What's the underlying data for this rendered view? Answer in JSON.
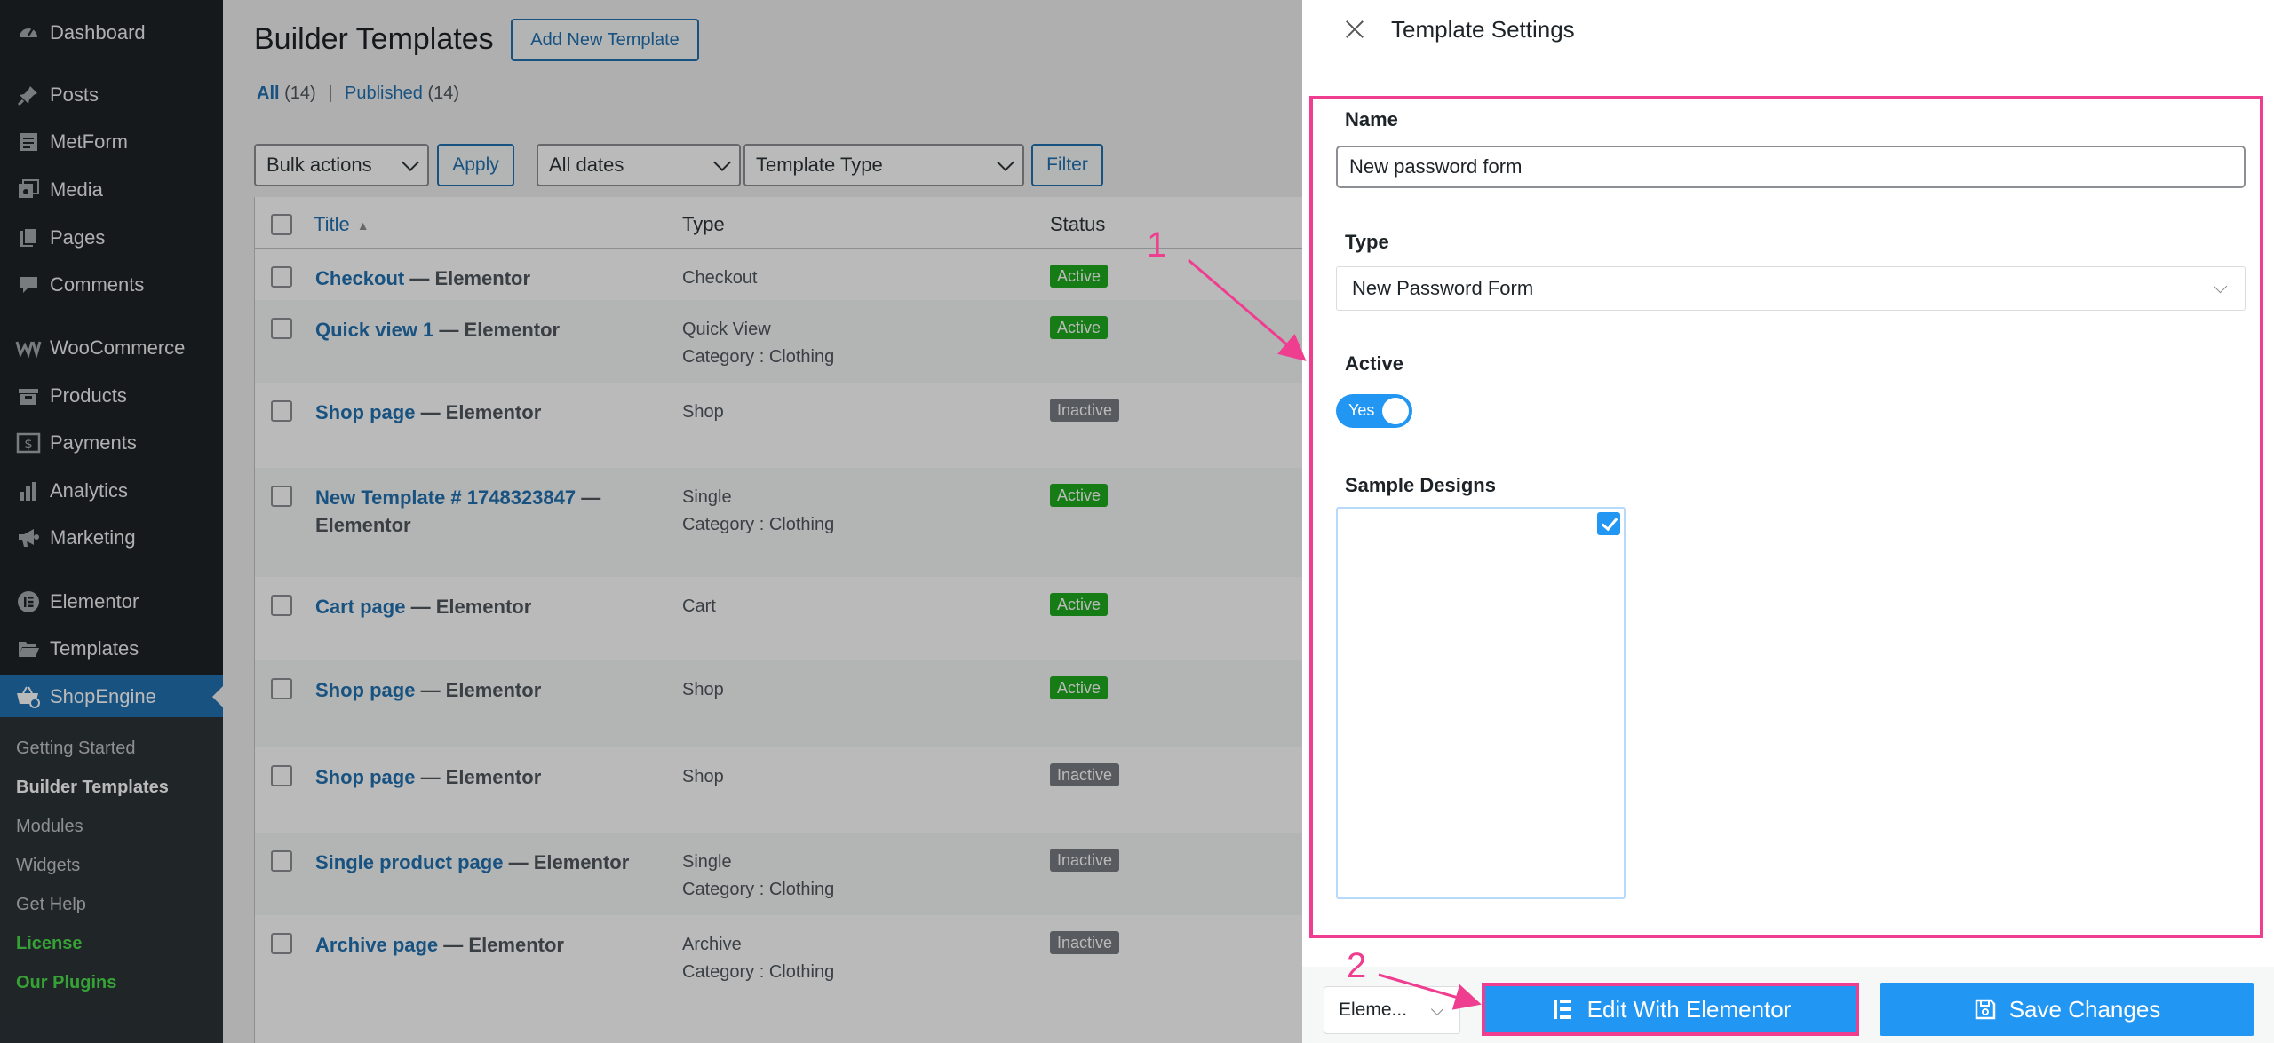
{
  "sidebar": {
    "items": [
      {
        "label": "Dashboard",
        "icon": "dashboard-icon"
      },
      {
        "label": "Posts",
        "icon": "pin-icon"
      },
      {
        "label": "MetForm",
        "icon": "form-icon"
      },
      {
        "label": "Media",
        "icon": "media-icon"
      },
      {
        "label": "Pages",
        "icon": "pages-icon"
      },
      {
        "label": "Comments",
        "icon": "comment-icon"
      },
      {
        "label": "WooCommerce",
        "icon": "woocommerce-icon"
      },
      {
        "label": "Products",
        "icon": "products-icon"
      },
      {
        "label": "Payments",
        "icon": "payments-icon"
      },
      {
        "label": "Analytics",
        "icon": "analytics-icon"
      },
      {
        "label": "Marketing",
        "icon": "megaphone-icon"
      },
      {
        "label": "Elementor",
        "icon": "elementor-icon"
      },
      {
        "label": "Templates",
        "icon": "folder-icon"
      },
      {
        "label": "ShopEngine",
        "icon": "shopengine-icon"
      }
    ],
    "submenu": [
      {
        "label": "Getting Started"
      },
      {
        "label": "Builder Templates"
      },
      {
        "label": "Modules"
      },
      {
        "label": "Widgets"
      },
      {
        "label": "Get Help"
      },
      {
        "label": "License"
      },
      {
        "label": "Our Plugins"
      }
    ]
  },
  "main": {
    "title": "Builder Templates",
    "add_new": "Add New Template",
    "filters": {
      "all": "All",
      "all_count": "(14)",
      "sep": "|",
      "published": "Published",
      "published_count": "(14)"
    },
    "bulk_actions": "Bulk actions",
    "apply": "Apply",
    "all_dates": "All dates",
    "template_type": "Template Type",
    "filter": "Filter",
    "columns": {
      "title": "Title",
      "type": "Type",
      "status": "Status"
    },
    "rows": [
      {
        "title": "Checkout",
        "suffix": " — Elementor",
        "type": "Checkout",
        "category": "",
        "status": "Active"
      },
      {
        "title": "Quick view 1",
        "suffix": " — Elementor",
        "type": "Quick View",
        "category": "Category : Clothing",
        "status": "Active"
      },
      {
        "title": "Shop page",
        "suffix": " — Elementor",
        "type": "Shop",
        "category": "",
        "status": "Inactive"
      },
      {
        "title": "New Template # 1748323847",
        "suffix": " — Elementor",
        "type": "Single",
        "category": "Category : Clothing",
        "status": "Active"
      },
      {
        "title": "Cart page",
        "suffix": " — Elementor",
        "type": "Cart",
        "category": "",
        "status": "Active"
      },
      {
        "title": "Shop page",
        "suffix": " — Elementor",
        "type": "Shop",
        "category": "",
        "status": "Active"
      },
      {
        "title": "Shop page",
        "suffix": " — Elementor",
        "type": "Shop",
        "category": "",
        "status": "Inactive"
      },
      {
        "title": "Single product page",
        "suffix": " — Elementor",
        "type": "Single",
        "category": "Category : Clothing",
        "status": "Inactive"
      },
      {
        "title": "Archive page",
        "suffix": " — Elementor",
        "type": "Archive",
        "category": "Category : Clothing",
        "status": "Inactive"
      }
    ]
  },
  "panel": {
    "title": "Template Settings",
    "name_label": "Name",
    "name_value": "New password form",
    "type_label": "Type",
    "type_value": "New Password Form",
    "active_label": "Active",
    "toggle_text": "Yes",
    "sample_label": "Sample Designs",
    "editor_select": "Eleme...",
    "edit_button": "Edit With Elementor",
    "save_button": "Save Changes"
  },
  "annotations": {
    "one": "1",
    "two": "2"
  },
  "colors": {
    "accent": "#2196f3",
    "wp_blue": "#2271b1",
    "highlight": "#ef3e8f",
    "active_badge": "#1faa1f",
    "inactive_badge": "#787c82",
    "sidebar": "#1d2327"
  }
}
